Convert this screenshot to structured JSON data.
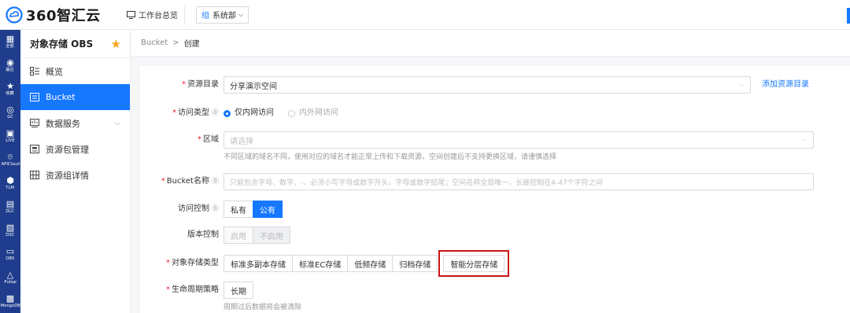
{
  "app": {
    "brand": "360智汇云"
  },
  "topbar": {
    "workbench_label": "工作台总览",
    "dept_mark": "组",
    "dept_label": "系统部"
  },
  "iconbar": [
    {
      "glyph": "▦",
      "label": "全部"
    },
    {
      "glyph": "◉",
      "label": "最近"
    },
    {
      "glyph": "★",
      "label": "收藏"
    },
    {
      "glyph": "◎",
      "label": "GC"
    },
    {
      "glyph": "▣",
      "label": "LIVE"
    },
    {
      "glyph": "⌾",
      "label": "APICloud"
    },
    {
      "glyph": "⬢",
      "label": "TLM"
    },
    {
      "glyph": "▤",
      "label": "DLC"
    },
    {
      "glyph": "▧",
      "label": "DSC"
    },
    {
      "glyph": "▭",
      "label": "OBS"
    },
    {
      "glyph": "△",
      "label": "Pulsar"
    },
    {
      "glyph": "▩",
      "label": "MongoDB"
    }
  ],
  "sidemenu": {
    "title": "对象存储 OBS",
    "items": [
      {
        "label": "概览",
        "icon": "overview-icon"
      },
      {
        "label": "Bucket",
        "icon": "bucket-icon"
      },
      {
        "label": "数据服务",
        "icon": "data-service-icon"
      },
      {
        "label": "资源包管理",
        "icon": "package-icon"
      },
      {
        "label": "资源组详情",
        "icon": "group-detail-icon"
      }
    ]
  },
  "breadcrumb": {
    "parent": "Bucket",
    "separator": ">",
    "current": "创建"
  },
  "form": {
    "resource_dir": {
      "label": "资源目录",
      "value": "分享演示空间",
      "add_link": "添加资源目录"
    },
    "access_type": {
      "label": "访问类型",
      "options": [
        "仅内网访问",
        "内外网访问"
      ],
      "selected": "仅内网访问"
    },
    "region": {
      "label": "区域",
      "placeholder": "请选择",
      "hint": "不同区域的域名不同，使用对应的域名才能正常上传和下载资源，空间创建后不支持更换区域，请谨慎选择"
    },
    "bucket_name": {
      "label": "Bucket名称",
      "placeholder": "只能包含字母、数字、-、必须小写字母或数字开头，字母或数字结尾；空间名称全局唯一，长度控制在4-47个字符之间"
    },
    "access_control": {
      "label": "访问控制",
      "options": [
        "私有",
        "公有"
      ],
      "selected": "公有"
    },
    "versioning": {
      "label": "版本控制",
      "options": [
        "启用",
        "不启用"
      ],
      "selected": "不启用"
    },
    "storage_class": {
      "label": "对象存储类型",
      "options": [
        "标准多副本存储",
        "标准EC存储",
        "低频存储",
        "归档存储",
        "智能分层存储"
      ],
      "highlighted": "智能分层存储"
    },
    "lifecycle": {
      "label": "生命周期策略",
      "value": "长期",
      "hint": "周期过后数据将会被清除"
    }
  },
  "colors": {
    "primary": "#1677ff",
    "iconbar": "#1f3d8c",
    "highlight_box": "#c81414",
    "required": "#f5222d"
  }
}
